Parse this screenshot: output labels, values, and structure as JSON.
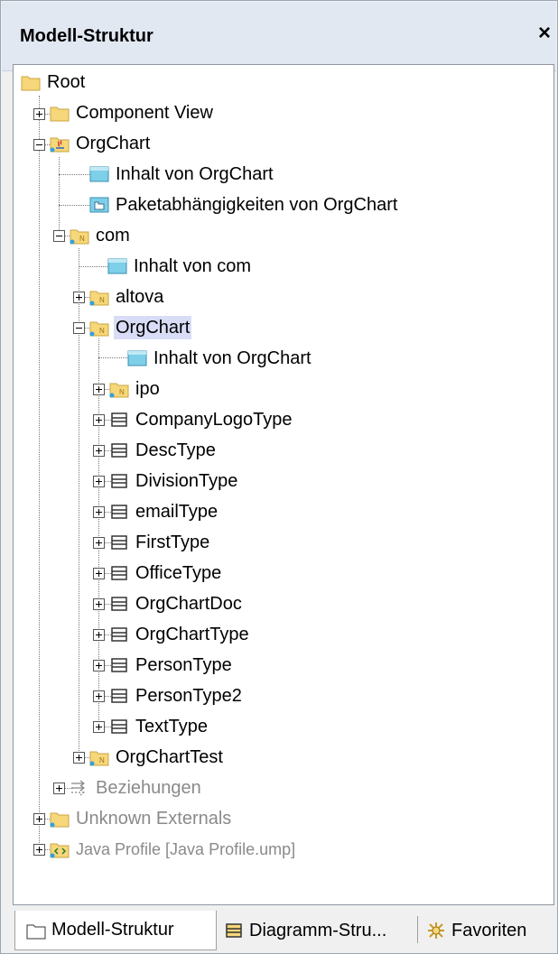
{
  "panel": {
    "title": "Modell-Struktur",
    "close_label": "×"
  },
  "tree": [
    {
      "label": "Root",
      "icon": "folder-icon"
    },
    {
      "label": "Component View",
      "icon": "folder-icon"
    },
    {
      "label": "OrgChart",
      "icon": "java-package-icon"
    },
    {
      "label": "Inhalt von OrgChart",
      "icon": "diagram-icon"
    },
    {
      "label": "Paketabhängigkeiten von OrgChart",
      "icon": "package-diagram-icon"
    },
    {
      "label": "com",
      "icon": "namespace-folder-icon"
    },
    {
      "label": "Inhalt von com",
      "icon": "diagram-icon"
    },
    {
      "label": "altova",
      "icon": "namespace-folder-icon"
    },
    {
      "label": "OrgChart",
      "icon": "namespace-folder-icon"
    },
    {
      "label": "Inhalt von OrgChart",
      "icon": "diagram-icon"
    },
    {
      "label": "ipo",
      "icon": "namespace-folder-icon"
    },
    {
      "label": "CompanyLogoType",
      "icon": "class-icon"
    },
    {
      "label": "DescType",
      "icon": "class-icon"
    },
    {
      "label": "DivisionType",
      "icon": "class-icon"
    },
    {
      "label": "emailType",
      "icon": "class-icon"
    },
    {
      "label": "FirstType",
      "icon": "class-icon"
    },
    {
      "label": "OfficeType",
      "icon": "class-icon"
    },
    {
      "label": "OrgChartDoc",
      "icon": "class-icon"
    },
    {
      "label": "OrgChartType",
      "icon": "class-icon"
    },
    {
      "label": "PersonType",
      "icon": "class-icon"
    },
    {
      "label": "PersonType2",
      "icon": "class-icon"
    },
    {
      "label": "TextType",
      "icon": "class-icon"
    },
    {
      "label": "OrgChartTest",
      "icon": "namespace-folder-icon"
    },
    {
      "label": "Beziehungen",
      "icon": "relations-icon"
    },
    {
      "label": "Unknown Externals",
      "icon": "folder-icon"
    },
    {
      "label": "Java Profile [Java Profile.ump]",
      "icon": "profile-folder-icon"
    }
  ],
  "tabs": [
    {
      "label": "Modell-Struktur",
      "icon": "folder-icon",
      "active": true
    },
    {
      "label": "Diagramm-Stru...",
      "icon": "diagram-tree-icon",
      "active": false
    },
    {
      "label": "Favoriten",
      "icon": "favorites-icon",
      "active": false
    }
  ],
  "colors": {
    "selection": "#d9dcf6",
    "folder": "#f6d77a",
    "muted_text": "#8a8a8a",
    "header": "#e2e8f2"
  }
}
